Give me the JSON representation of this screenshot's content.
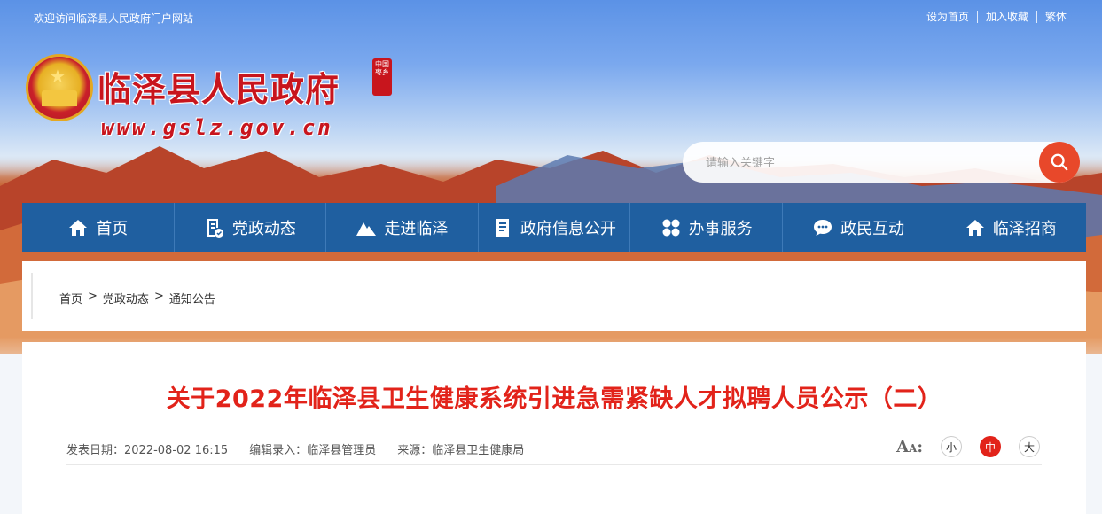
{
  "topbar": {
    "welcome": "欢迎访问临泽县人民政府门户网站",
    "links": [
      "设为首页",
      "加入收藏",
      "繁体"
    ]
  },
  "header": {
    "site_name": "临泽县人民政府",
    "seal_text": "中国枣乡",
    "site_url": "www.gslz.gov.cn"
  },
  "search": {
    "placeholder": "请输入关键字"
  },
  "nav": {
    "items": [
      {
        "label": "首页",
        "icon": "home-icon"
      },
      {
        "label": "党政动态",
        "icon": "document-check-icon"
      },
      {
        "label": "走进临泽",
        "icon": "mountain-icon"
      },
      {
        "label": "政府信息公开",
        "icon": "clipboard-icon"
      },
      {
        "label": "办事服务",
        "icon": "grid-icon"
      },
      {
        "label": "政民互动",
        "icon": "chat-icon"
      },
      {
        "label": "临泽招商",
        "icon": "home-icon"
      }
    ]
  },
  "breadcrumb": {
    "items": [
      "首页",
      "党政动态",
      "通知公告"
    ],
    "separator": ">"
  },
  "article": {
    "title": "关于2022年临泽县卫生健康系统引进急需紧缺人才拟聘人员公示（二）",
    "publish_label": "发表日期：",
    "publish_date": "2022-08-02 16:15",
    "editor_label": "编辑录入：",
    "editor": "临泽县管理员",
    "source_label": "来源：",
    "source": "临泽县卫生健康局",
    "font_sizes": [
      "小",
      "中",
      "大"
    ],
    "font_size_selected": "中"
  },
  "colors": {
    "nav_bg": "#1f5fa0",
    "title_red": "#e2231a",
    "brand_red": "#c8151d",
    "search_button": "#e8482a"
  }
}
